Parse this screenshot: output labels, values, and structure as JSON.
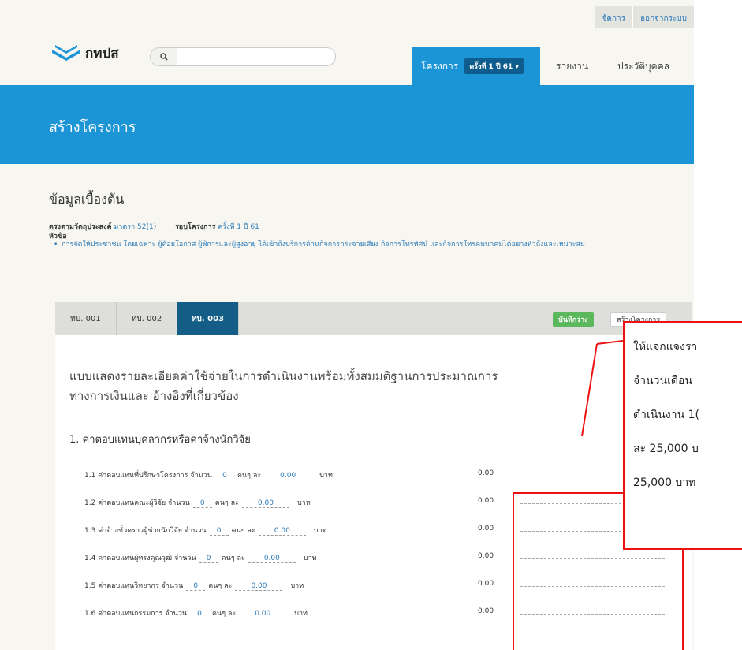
{
  "util": {
    "manage": "จัดการ",
    "logout": "ออกจากระบบ"
  },
  "brand": {
    "name": "กทปส"
  },
  "search": {
    "placeholder": ""
  },
  "nav": {
    "projects": "โครงการ",
    "round_badge": "ครั้งที่ 1 ปี 61 ▾",
    "reports": "รายงาน",
    "profile": "ประวัติบุคคล"
  },
  "banner": {
    "title": "สร้างโครงการ"
  },
  "info": {
    "heading": "ข้อมูลเบื้องต้น",
    "objective_label": "ตรงตามวัตถุประสงค์",
    "objective_value": "มาตรา 52(1)",
    "round_label": "รอบโครงการ",
    "round_value": "ครั้งที่ 1 ปี 61",
    "topic_label": "หัวข้อ",
    "topic_value": "การจัดให้ประชาชน โดยเฉพาะ ผู้ด้อยโอกาส ผู้พิการและผู้สูงอายุ ได้เข้าถึงบริการด้านกิจการกระจายเสียง กิจการโทรทัศน์ และกิจการโทรคมนาคมได้อย่างทั่วถึงและเหมาะสม"
  },
  "tabs": [
    {
      "label": "ทบ. 001"
    },
    {
      "label": "ทบ. 002"
    },
    {
      "label": "ทบ. 003"
    }
  ],
  "buttons": {
    "save_draft": "บันทึกร่าง",
    "create_project": "สร้างโครงการ"
  },
  "form": {
    "title": "แบบแสดงรายละเอียดค่าใช้จ่ายในการดำเนินงานพร้อมทั้งสมมติฐานการประมาณการทางการเงินและ อ้างอิงที่เกี่ยวข้อง",
    "section1": "1. ค่าตอบแทนบุคลากรหรือค่าจ้างนักวิจัย",
    "rows": [
      {
        "label": "1.1 ค่าตอบแทนที่ปรึกษาโครงการ จำนวน",
        "count": "0",
        "per": "คนๆ ละ",
        "rate": "0.00",
        "unit": "บาท",
        "amount": "0.00"
      },
      {
        "label": "1.2 ค่าตอบแทนคณะผู้วิจัย จำนวน",
        "count": "0",
        "per": "คนๆ ละ",
        "rate": "0.00",
        "unit": "บาท",
        "amount": "0.00"
      },
      {
        "label": "1.3 ค่าจ้างชั่วคราวผู้ช่วยนักวิจัย จำนวน",
        "count": "0",
        "per": "คนๆ ละ",
        "rate": "0.00",
        "unit": "บาท",
        "amount": "0.00"
      },
      {
        "label": "1.4 ค่าตอบแทนผู้ทรงคุณวุฒิ จำนวน",
        "count": "0",
        "per": "คนๆ ละ",
        "rate": "0.00",
        "unit": "บาท",
        "amount": "0.00"
      },
      {
        "label": "1.5 ค่าตอบแทนวิทยากร จำนวน",
        "count": "0",
        "per": "คนๆ ละ",
        "rate": "0.00",
        "unit": "บาท",
        "amount": "0.00"
      },
      {
        "label": "1.6 ค่าตอบแทนกรรมการ จำนวน",
        "count": "0",
        "per": "คนๆ ละ",
        "rate": "0.00",
        "unit": "บาท",
        "amount": "0.00"
      }
    ]
  },
  "callout": {
    "lines": [
      "ให้แจกแจงรา",
      "จำนวนเดือน",
      "ดำเนินงาน 1(",
      "ละ 25,000 บ",
      "25,000 บาท"
    ]
  },
  "colors": {
    "brand_blue": "#1b95d6",
    "tab_active": "#145d86",
    "save_green": "#5cb85c",
    "annotation_red": "#ee1111"
  }
}
